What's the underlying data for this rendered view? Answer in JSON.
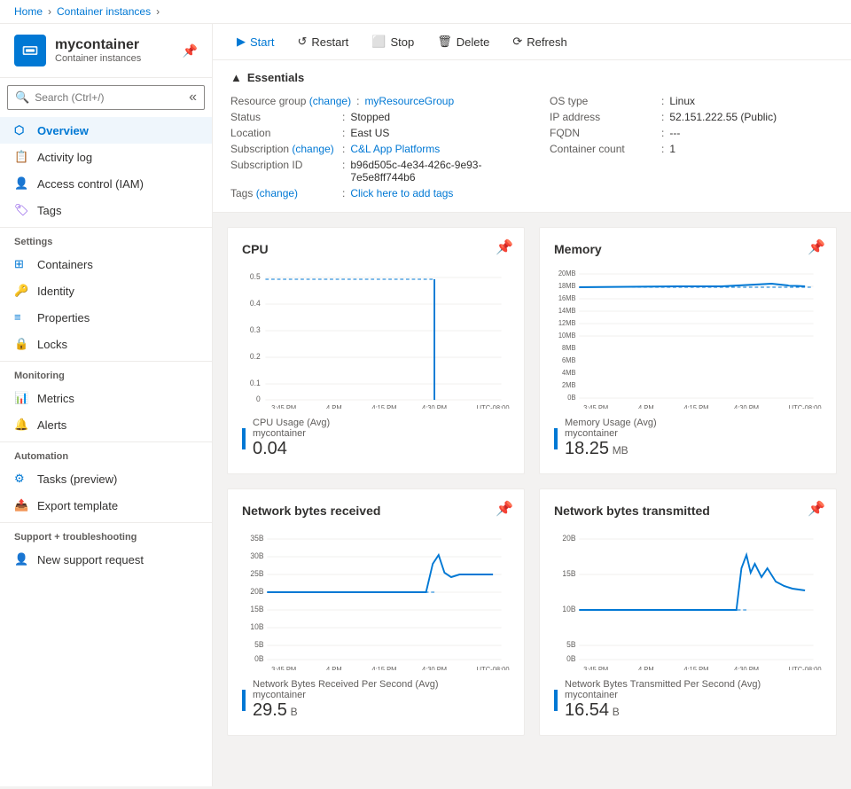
{
  "breadcrumb": {
    "items": [
      "Home",
      "Container instances"
    ],
    "separator": ">"
  },
  "header": {
    "icon_label": "container-icon",
    "title": "mycontainer",
    "subtitle": "Container instances",
    "pin_label": "📌"
  },
  "search": {
    "placeholder": "Search (Ctrl+/)"
  },
  "nav": {
    "main_items": [
      {
        "id": "overview",
        "label": "Overview",
        "icon": "overview",
        "active": true
      },
      {
        "id": "activity-log",
        "label": "Activity log",
        "icon": "activity"
      },
      {
        "id": "access-control",
        "label": "Access control (IAM)",
        "icon": "access"
      },
      {
        "id": "tags",
        "label": "Tags",
        "icon": "tags"
      }
    ],
    "sections": [
      {
        "label": "Settings",
        "items": [
          {
            "id": "containers",
            "label": "Containers",
            "icon": "containers"
          },
          {
            "id": "identity",
            "label": "Identity",
            "icon": "identity"
          },
          {
            "id": "properties",
            "label": "Properties",
            "icon": "properties"
          },
          {
            "id": "locks",
            "label": "Locks",
            "icon": "locks"
          }
        ]
      },
      {
        "label": "Monitoring",
        "items": [
          {
            "id": "metrics",
            "label": "Metrics",
            "icon": "metrics"
          },
          {
            "id": "alerts",
            "label": "Alerts",
            "icon": "alerts"
          }
        ]
      },
      {
        "label": "Automation",
        "items": [
          {
            "id": "tasks",
            "label": "Tasks (preview)",
            "icon": "tasks"
          },
          {
            "id": "export",
            "label": "Export template",
            "icon": "export"
          }
        ]
      },
      {
        "label": "Support + troubleshooting",
        "items": [
          {
            "id": "new-support",
            "label": "New support request",
            "icon": "support"
          }
        ]
      }
    ]
  },
  "toolbar": {
    "buttons": [
      {
        "id": "start",
        "label": "Start",
        "icon": "▶",
        "style": "primary"
      },
      {
        "id": "restart",
        "label": "Restart",
        "icon": "↺"
      },
      {
        "id": "stop",
        "label": "Stop",
        "icon": "□"
      },
      {
        "id": "delete",
        "label": "Delete",
        "icon": "🗑"
      },
      {
        "id": "refresh",
        "label": "Refresh",
        "icon": "⟳"
      }
    ]
  },
  "essentials": {
    "title": "Essentials",
    "rows_left": [
      {
        "label": "Resource group (change)",
        "value": "myResourceGroup",
        "link": true
      },
      {
        "label": "Status",
        "value": "Stopped"
      },
      {
        "label": "Location",
        "value": "East US"
      },
      {
        "label": "Subscription (change)",
        "value": "C&L App Platforms",
        "link": true
      },
      {
        "label": "Subscription ID",
        "value": "b96d505c-4e34-426c-9e93-7e5e8ff744b6"
      },
      {
        "label": "Tags (change)",
        "value": "Click here to add tags",
        "link": true
      }
    ],
    "rows_right": [
      {
        "label": "OS type",
        "value": "Linux"
      },
      {
        "label": "IP address",
        "value": "52.151.222.55 (Public)"
      },
      {
        "label": "FQDN",
        "value": "---"
      },
      {
        "label": "Container count",
        "value": "1"
      }
    ]
  },
  "charts": {
    "row1": [
      {
        "id": "cpu",
        "title": "CPU",
        "legend_label": "CPU Usage (Avg)",
        "legend_sublabel": "mycontainer",
        "legend_value": "0.04",
        "legend_unit": "",
        "y_labels": [
          "0.5",
          "0.4",
          "0.3",
          "0.2",
          "0.1",
          "0"
        ],
        "x_labels": [
          "3:45 PM",
          "4 PM",
          "4:15 PM",
          "4:30 PM",
          "UTC-08:00"
        ],
        "color": "#0078d4"
      },
      {
        "id": "memory",
        "title": "Memory",
        "legend_label": "Memory Usage (Avg)",
        "legend_sublabel": "mycontainer",
        "legend_value": "18.25",
        "legend_unit": "MB",
        "y_labels": [
          "20MB",
          "18MB",
          "16MB",
          "14MB",
          "12MB",
          "10MB",
          "8MB",
          "6MB",
          "4MB",
          "2MB",
          "0B"
        ],
        "x_labels": [
          "3:45 PM",
          "4 PM",
          "4:15 PM",
          "4:30 PM",
          "UTC-08:00"
        ],
        "color": "#0078d4"
      }
    ],
    "row2": [
      {
        "id": "network-received",
        "title": "Network bytes received",
        "legend_label": "Network Bytes Received Per Second (Avg)",
        "legend_sublabel": "mycontainer",
        "legend_value": "29.5",
        "legend_unit": "B",
        "y_labels": [
          "35B",
          "30B",
          "25B",
          "20B",
          "15B",
          "10B",
          "5B",
          "0B"
        ],
        "x_labels": [
          "3:45 PM",
          "4 PM",
          "4:15 PM",
          "4:30 PM",
          "UTC-08:00"
        ],
        "color": "#0078d4"
      },
      {
        "id": "network-transmitted",
        "title": "Network bytes transmitted",
        "legend_label": "Network Bytes Transmitted Per Second (Avg)",
        "legend_sublabel": "mycontainer",
        "legend_value": "16.54",
        "legend_unit": "B",
        "y_labels": [
          "20B",
          "15B",
          "10B",
          "5B",
          "0B"
        ],
        "x_labels": [
          "3:45 PM",
          "4 PM",
          "4:15 PM",
          "4:30 PM",
          "UTC-08:00"
        ],
        "color": "#0078d4"
      }
    ]
  }
}
